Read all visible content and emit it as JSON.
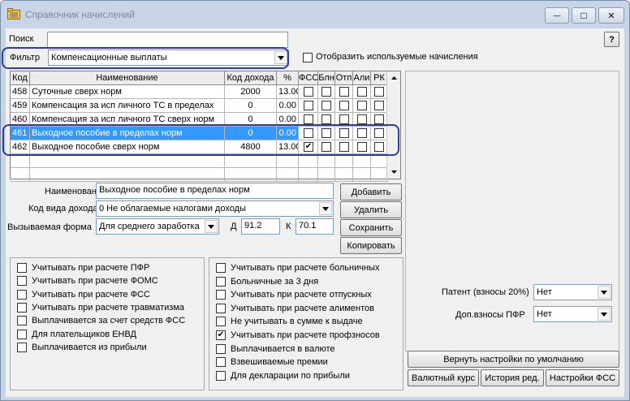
{
  "window": {
    "title": "Справочник начислений",
    "minimize": "—",
    "maximize": "□",
    "close": "✕",
    "help": "?"
  },
  "search": {
    "label": "Поиск",
    "value": ""
  },
  "filter": {
    "label": "Фильтр",
    "value": "Компенсационные выплаты"
  },
  "show_used": {
    "label": "Отобразить используемые начисления",
    "checked": false
  },
  "table": {
    "headers": [
      "Код",
      "Наименование",
      "Код дохода",
      "%",
      "ФСС",
      "Блн",
      "Отп",
      "Али",
      "РК"
    ],
    "rows": [
      {
        "code": "458",
        "name": "Суточные сверх норм",
        "income": "2000",
        "pct": "13.00",
        "fss": "",
        "bln": "",
        "otp": "",
        "ali": "",
        "rk": ""
      },
      {
        "code": "459",
        "name": "Компенсация за исп личного ТС в пределах",
        "income": "0",
        "pct": "0.00",
        "fss": "",
        "bln": "",
        "otp": "",
        "ali": "",
        "rk": ""
      },
      {
        "code": "460",
        "name": "Компенсация за исп личного ТС сверх норм",
        "income": "0",
        "pct": "0.00",
        "fss": "",
        "bln": "",
        "otp": "",
        "ali": "",
        "rk": ""
      },
      {
        "code": "461",
        "name": "Выходное пособие в пределах норм",
        "income": "0",
        "pct": "0.00",
        "fss": "",
        "bln": "",
        "otp": "",
        "ali": "",
        "rk": ""
      },
      {
        "code": "462",
        "name": "Выходное пособие сверх норм",
        "income": "4800",
        "pct": "13.00",
        "fss": "✔",
        "bln": "",
        "otp": "",
        "ali": "",
        "rk": ""
      }
    ]
  },
  "form": {
    "name_label": "Наименование",
    "name_value": "Выходное пособие в пределах норм",
    "income_type_label": "Код вида дохода",
    "income_type_value": "0 Не облагаемые налогами доходы",
    "called_form_label": "Вызываемая форма",
    "called_form_value": "Для среднего заработка",
    "d_label": "Д",
    "d_value": "91.2",
    "k_label": "К",
    "k_value": "70.1"
  },
  "buttons": {
    "add": "Добавить",
    "delete": "Удалить",
    "save": "Сохранить",
    "copy": "Копировать",
    "reset": "Вернуть настройки по умолчанию",
    "currency": "Валютный курс",
    "history": "История ред.",
    "fss_settings": "Настройки ФСС"
  },
  "left_checks": [
    "Учитывать при расчете ПФР",
    "Учитывать при расчете ФОМС",
    "Учитывать при расчете ФСС",
    "Учитывать при расчете травматизма",
    "Выплачивается за счет средств ФСС",
    "Для плательщиков ЕНВД",
    "Выплачивается из прибыли"
  ],
  "right_checks": [
    {
      "label": "Учитывать при расчете больничных",
      "mark": ""
    },
    {
      "label": "Больничные за 3 дня",
      "mark": ""
    },
    {
      "label": "Учитывать при расчете отпускных",
      "mark": ""
    },
    {
      "label": "Учитывать при расчете алиментов",
      "mark": ""
    },
    {
      "label": "Не учитывать в сумме к выдаче",
      "mark": ""
    },
    {
      "label": "Учитывать при расчете профзносов",
      "mark": "✔"
    },
    {
      "label": "Выплачивается в валюте",
      "mark": ""
    },
    {
      "label": "Взвешиваемые премии",
      "mark": ""
    },
    {
      "label": "Для декларации по прибыли",
      "mark": ""
    }
  ],
  "patent": {
    "label": "Патент (взносы 20%)",
    "value": "Нет"
  },
  "pfr": {
    "label": "Доп.взносы ПФР",
    "value": "Нет"
  },
  "colors": {
    "selection": "#3399ff",
    "highlight": "#2f3aa8"
  }
}
